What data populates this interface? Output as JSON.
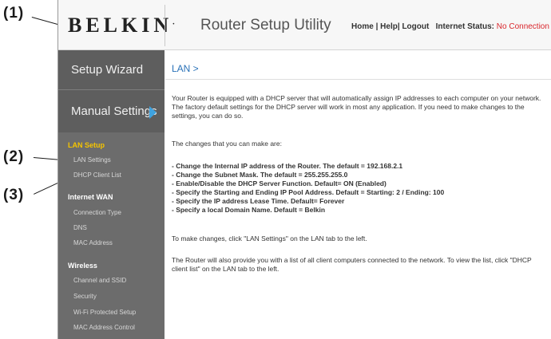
{
  "callouts": {
    "c1": "(1)",
    "c2": "(2)",
    "c3": "(3)"
  },
  "header": {
    "logo": "BELKIN",
    "logo_mark": ".",
    "app_title": "Router Setup Utility",
    "nav": [
      "Home",
      "Help",
      "Logout"
    ],
    "nav_sep": "|",
    "status_label": "Internet Status:",
    "status_value": "No Connection"
  },
  "sidebar": {
    "setup_wizard": "Setup Wizard",
    "manual_settings": "Manual Settings",
    "sections": [
      {
        "title": "LAN Setup",
        "items": [
          "LAN Settings",
          "DHCP Client List"
        ]
      },
      {
        "title": "Internet WAN",
        "items": [
          "Connection Type",
          "DNS",
          "MAC Address"
        ]
      },
      {
        "title": "Wireless",
        "items": [
          "Channel and SSID",
          "Security",
          "Wi-Fi Protected Setup",
          "MAC Address Control"
        ]
      }
    ]
  },
  "main": {
    "title": "LAN >",
    "intro": "Your Router is equipped with a DHCP server that will automatically assign IP addresses to each computer on your network. The factory default settings for the DHCP server will work in most any application. If you need to make changes to the settings, you can do so.",
    "changes_intro": "The changes that you can make are:",
    "changes": [
      "- Change the Internal IP address of the Router. The default = 192.168.2.1",
      "- Change the Subnet Mask. The default = 255.255.255.0",
      "- Enable/Disable the DHCP Server Function. Default= ON (Enabled)",
      "- Specify the Starting and Ending IP Pool Address. Default = Starting: 2 / Ending: 100",
      "- Specify the IP address Lease Time. Default= Forever",
      "- Specify a local Domain Name. Default = Belkin"
    ],
    "to_make_changes": "To make changes, click \"LAN Settings\" on the LAN tab to the left.",
    "client_list_note": "The Router will also provide you with a list of all client computers connected to the network. To view the list, click \"DHCP client list\" on the LAN tab to the left."
  },
  "colors": {
    "accent_blue": "#2a72b8",
    "active_section": "#f5c400",
    "status_red": "#d9262c",
    "sidebar_bg": "#6c6c6c"
  },
  "icons": {
    "manual_settings_arrow": "triangle-right-icon"
  }
}
